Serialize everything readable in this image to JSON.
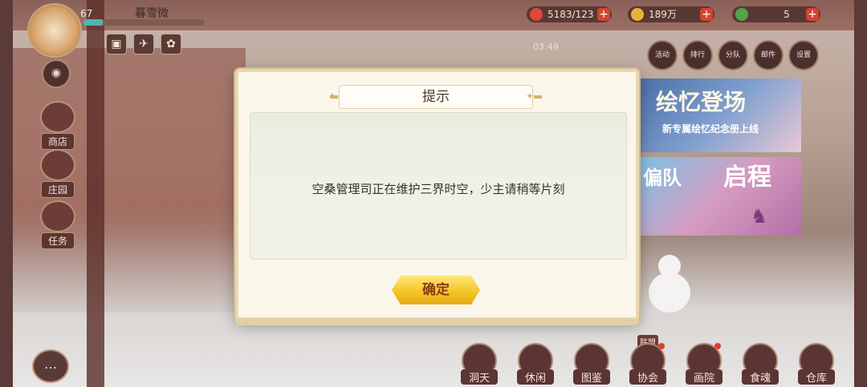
{
  "player": {
    "level": "67",
    "name": "暮雪微",
    "progress_fraction": 0.16
  },
  "resources": [
    {
      "value": "5183/123",
      "icon": "stamina-icon",
      "color": "#e0453a"
    },
    {
      "value": "189万",
      "icon": "coin-icon",
      "color": "#e8b23a"
    },
    {
      "value": "5",
      "icon": "gem-icon",
      "color": "#53a34a"
    }
  ],
  "fish_timer": "03:49",
  "top_menu": [
    "活动",
    "排行",
    "分队",
    "邮件",
    "设置"
  ],
  "side_menu": {
    "shop": "商店",
    "manor": "庄园",
    "task": "任务"
  },
  "banners": {
    "banner1_title": "绘忆登场",
    "banner1_sub": "新专属绘忆纪念册上线",
    "banner2_left": "偏队",
    "banner2_right": "启程"
  },
  "bottom_menu": {
    "tag": "联盟",
    "items": [
      "洞天",
      "休闲",
      "图鉴",
      "协会",
      "画院",
      "食魂",
      "仓库"
    ]
  },
  "dialog": {
    "title": "提示",
    "message": "空桑管理司正在维护三界时空，少主请稍等片刻",
    "confirm_label": "确定"
  }
}
